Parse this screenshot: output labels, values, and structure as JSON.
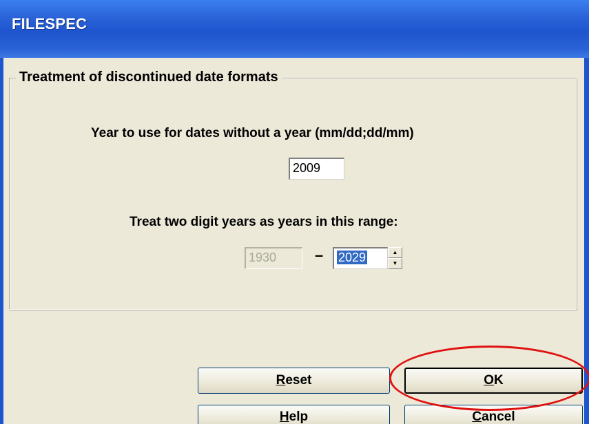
{
  "window": {
    "title": "FILESPEC"
  },
  "group": {
    "title": "Treatment of discontinued date formats"
  },
  "year_default": {
    "label": "Year to use for dates without a year (mm/dd;dd/mm)",
    "value": "2009"
  },
  "two_digit_range": {
    "label": "Treat two digit years as years in this range:",
    "low": "1930",
    "separator": "–",
    "high": "2029"
  },
  "buttons": {
    "reset": {
      "mnemonic": "R",
      "rest": "eset"
    },
    "ok": {
      "mnemonic": "O",
      "rest": "K"
    },
    "help": {
      "mnemonic": "H",
      "rest": "elp"
    },
    "cancel": {
      "mnemonic": "C",
      "rest": "ancel"
    }
  },
  "colors": {
    "titlebar": "#1e55cf",
    "face": "#ece9d8",
    "selection": "#316ac5",
    "annotation": "#e01010"
  },
  "icons": {
    "spin_up": "spin-up-arrow-icon",
    "spin_down": "spin-down-arrow-icon"
  }
}
